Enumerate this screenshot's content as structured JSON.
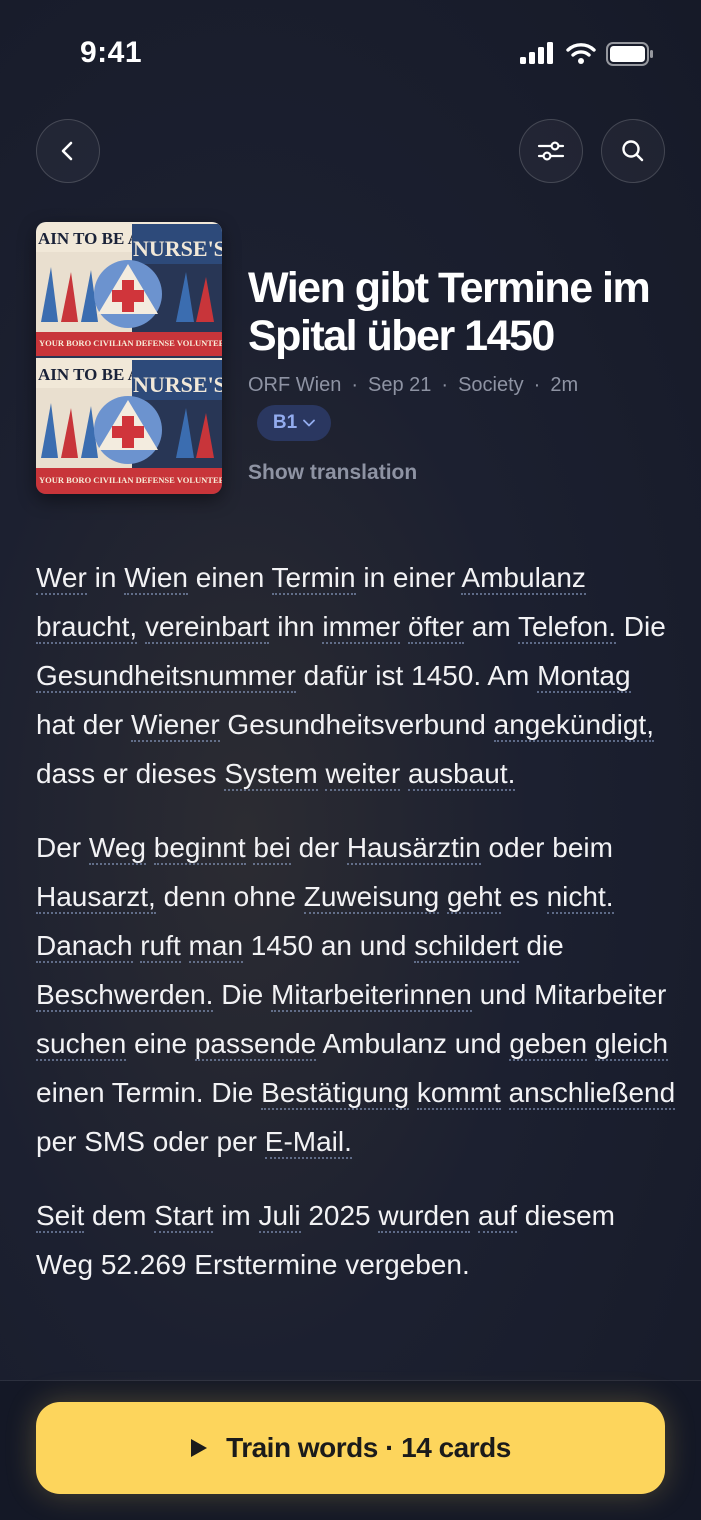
{
  "status_bar": {
    "time": "9:41"
  },
  "icons": {
    "back": "chevron-left-icon",
    "filters": "sliders-icon",
    "search": "search-icon",
    "play": "play-icon"
  },
  "cover": {
    "poster_lines": [
      "AIN TO BE A",
      "NURSE'S AI",
      "YOUR BORO CIVILIAN DEFENSE VOLUNTEER"
    ]
  },
  "article": {
    "title": "Wien gibt Termine im Spital über 1450",
    "source": "ORF Wien",
    "date": "Sep 21",
    "category": "Society",
    "read_time": "2m",
    "separator": "·",
    "level": "B1",
    "show_translation": "Show translation",
    "paragraphs": [
      [
        {
          "t": "Wer",
          "u": true
        },
        {
          "t": " in "
        },
        {
          "t": "Wien",
          "u": true
        },
        {
          "t": " einen "
        },
        {
          "t": "Termin",
          "u": true
        },
        {
          "t": " in einer "
        },
        {
          "t": "Ambulanz",
          "u": true
        },
        {
          "t": " "
        },
        {
          "t": "braucht,",
          "u": true
        },
        {
          "t": " "
        },
        {
          "t": "vereinbart",
          "u": true
        },
        {
          "t": " ihn "
        },
        {
          "t": "immer",
          "u": true
        },
        {
          "t": " "
        },
        {
          "t": "öfter",
          "u": true
        },
        {
          "t": " am "
        },
        {
          "t": "Telefon.",
          "u": true
        },
        {
          "t": " Die "
        },
        {
          "t": "Gesundheitsnummer",
          "u": true
        },
        {
          "t": " dafür ist 1450. Am "
        },
        {
          "t": "Montag",
          "u": true
        },
        {
          "t": " hat der "
        },
        {
          "t": "Wiener",
          "u": true
        },
        {
          "t": " Gesundheitsverbund "
        },
        {
          "t": "angekündigt,",
          "u": true
        },
        {
          "t": " dass er dieses "
        },
        {
          "t": "System",
          "u": true
        },
        {
          "t": " "
        },
        {
          "t": "weiter",
          "u": true
        },
        {
          "t": " "
        },
        {
          "t": "ausbaut.",
          "u": true
        }
      ],
      [
        {
          "t": "Der "
        },
        {
          "t": "Weg",
          "u": true
        },
        {
          "t": " "
        },
        {
          "t": "beginnt",
          "u": true
        },
        {
          "t": " "
        },
        {
          "t": "bei",
          "u": true
        },
        {
          "t": " der "
        },
        {
          "t": "Hausärztin",
          "u": true
        },
        {
          "t": " oder beim "
        },
        {
          "t": "Hausarzt,",
          "u": true
        },
        {
          "t": " denn ohne "
        },
        {
          "t": "Zuweisung",
          "u": true
        },
        {
          "t": " "
        },
        {
          "t": "geht",
          "u": true
        },
        {
          "t": " es "
        },
        {
          "t": "nicht.",
          "u": true
        },
        {
          "t": " "
        },
        {
          "t": "Danach",
          "u": true
        },
        {
          "t": " "
        },
        {
          "t": "ruft",
          "u": true
        },
        {
          "t": " "
        },
        {
          "t": "man",
          "u": true
        },
        {
          "t": " 1450 an und "
        },
        {
          "t": "schildert",
          "u": true
        },
        {
          "t": " die "
        },
        {
          "t": "Beschwerden.",
          "u": true
        },
        {
          "t": " Die "
        },
        {
          "t": "Mitarbeiterinnen",
          "u": true
        },
        {
          "t": " und Mitarbeiter "
        },
        {
          "t": "suchen",
          "u": true
        },
        {
          "t": " eine "
        },
        {
          "t": "passende",
          "u": true
        },
        {
          "t": " Ambulanz und "
        },
        {
          "t": "geben",
          "u": true
        },
        {
          "t": " "
        },
        {
          "t": "gleich",
          "u": true
        },
        {
          "t": " einen Termin. Die "
        },
        {
          "t": "Bestätigung",
          "u": true
        },
        {
          "t": " "
        },
        {
          "t": "kommt",
          "u": true
        },
        {
          "t": " "
        },
        {
          "t": "anschließend",
          "u": true
        },
        {
          "t": " per SMS oder per "
        },
        {
          "t": "E-Mail.",
          "u": true
        }
      ],
      [
        {
          "t": "Seit",
          "u": true
        },
        {
          "t": " dem "
        },
        {
          "t": "Start",
          "u": true
        },
        {
          "t": " im "
        },
        {
          "t": "Juli",
          "u": true
        },
        {
          "t": " 2025 "
        },
        {
          "t": "wurden",
          "u": true
        },
        {
          "t": " "
        },
        {
          "t": "auf",
          "u": true
        },
        {
          "t": " diesem Weg 52.269 Ersttermine vergeben."
        }
      ]
    ]
  },
  "cta": {
    "label": "Train words · 14 cards"
  },
  "colors": {
    "accent": "#fdd55c",
    "level_bg": "#2a3760",
    "level_text": "#93acef"
  }
}
